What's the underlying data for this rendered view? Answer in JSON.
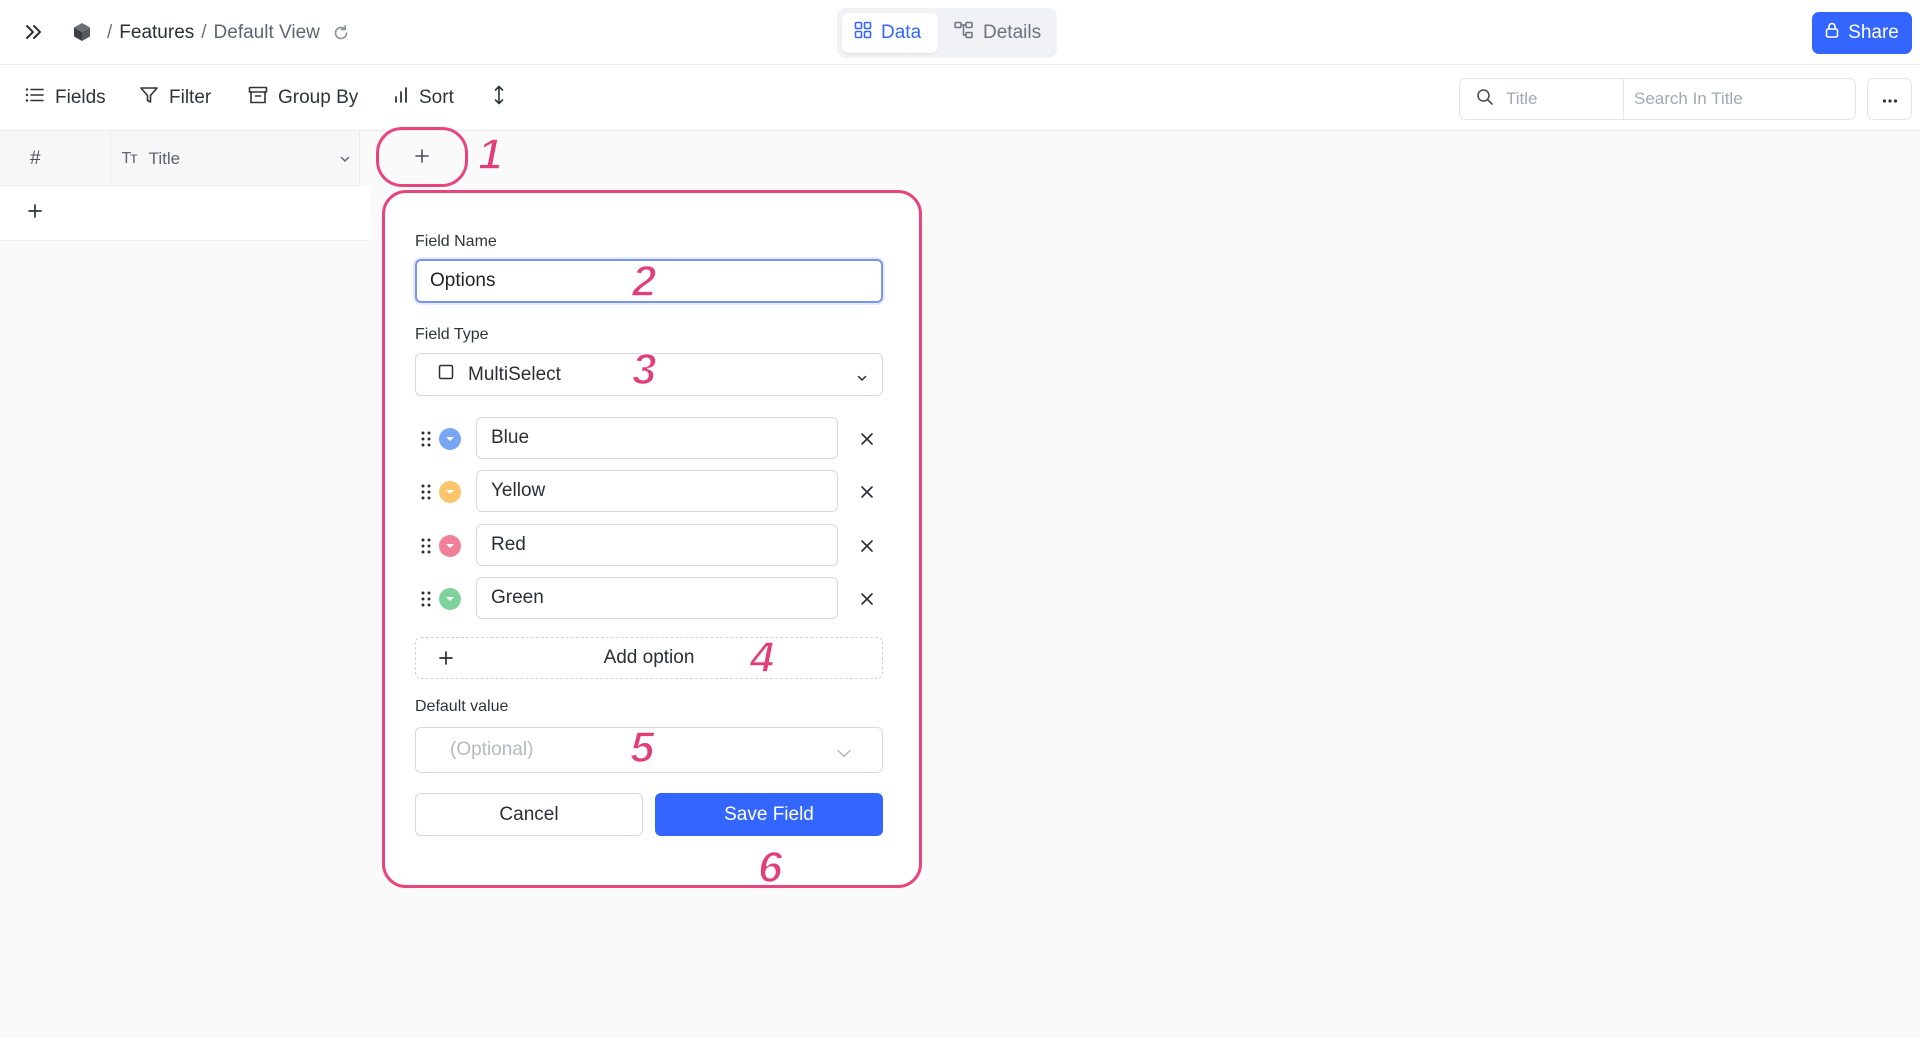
{
  "breadcrumb": {
    "separator": "/",
    "base": "Features",
    "view": "Default View"
  },
  "view_tabs": [
    {
      "label": "Data",
      "icon": "grid-icon",
      "active": true
    },
    {
      "label": "Details",
      "icon": "schema-icon",
      "active": false
    }
  ],
  "share": {
    "label": "Share",
    "icon": "lock-icon"
  },
  "toolbar": {
    "fields_label": "Fields",
    "filter_label": "Filter",
    "group_by_label": "Group By",
    "sort_label": "Sort",
    "search_field": "Title",
    "search_placeholder": "Search In Title"
  },
  "grid": {
    "row_number_header": "#",
    "title_header_icon": "Tт",
    "title_header": "Title"
  },
  "field_dialog": {
    "field_name_label": "Field Name",
    "field_name_value": "Options",
    "field_type_label": "Field Type",
    "field_type_value": "MultiSelect",
    "options": [
      {
        "label": "Blue",
        "color": "#78a6f5"
      },
      {
        "label": "Yellow",
        "color": "#fbc56b"
      },
      {
        "label": "Red",
        "color": "#f27f98"
      },
      {
        "label": "Green",
        "color": "#7ed39a"
      }
    ],
    "add_option_label": "Add option",
    "default_value_label": "Default value",
    "default_value_placeholder": "(Optional)",
    "cancel_label": "Cancel",
    "save_label": "Save Field"
  },
  "annotations": [
    "1",
    "2",
    "3",
    "4",
    "5",
    "6"
  ],
  "colors": {
    "accent": "#3366ff",
    "annotation": "#e8457e"
  }
}
